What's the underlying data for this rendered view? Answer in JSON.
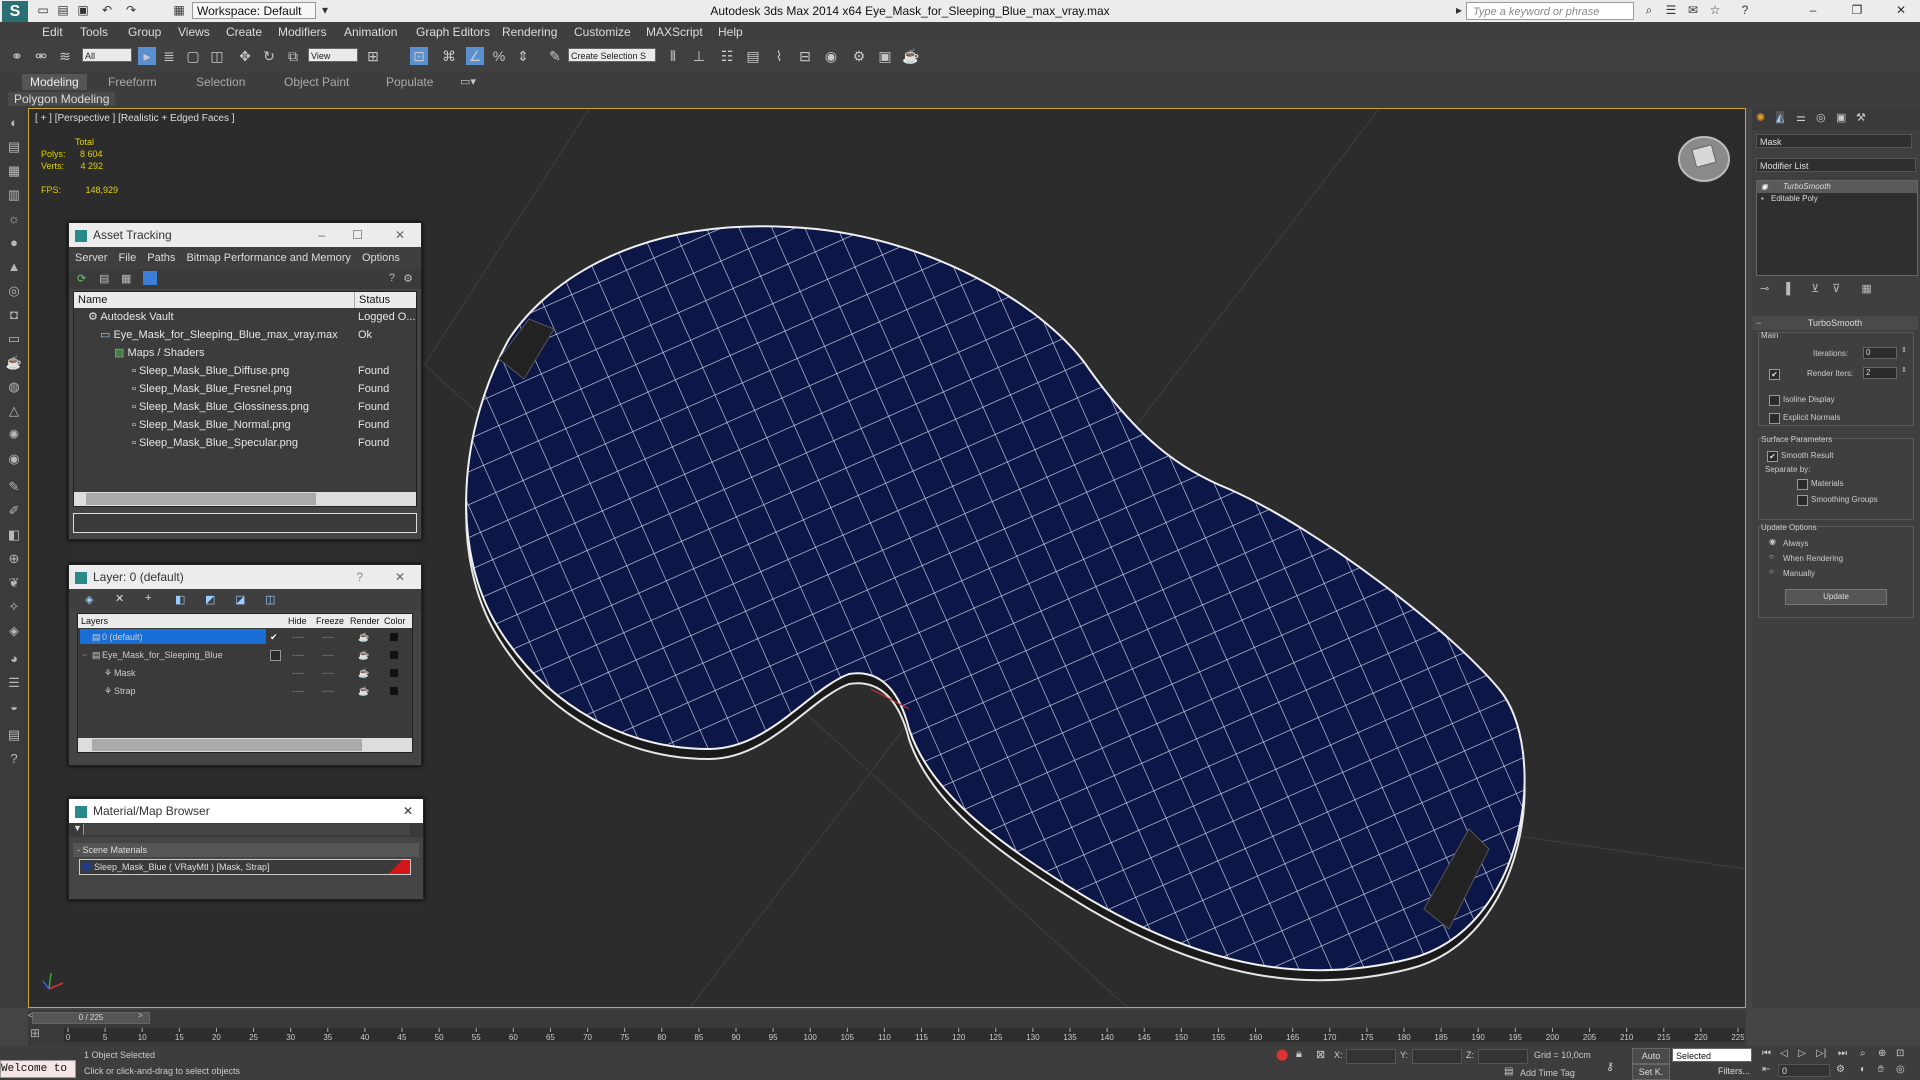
{
  "title_bar": {
    "app_icon": "3ds-max-logo-icon",
    "workspace": "Workspace: Default",
    "window_title": "Autodesk 3ds Max  2014 x64      Eye_Mask_for_Sleeping_Blue_max_vray.max",
    "search_placeholder": "Type a keyword or phrase"
  },
  "menu": [
    "Edit",
    "Tools",
    "Group",
    "Views",
    "Create",
    "Modifiers",
    "Animation",
    "Graph Editors",
    "Rendering",
    "Customize",
    "MAXScript",
    "Help"
  ],
  "toolbar": {
    "selection_filter": "All",
    "ref_coord": "View",
    "named_selection": "Create Selection S"
  },
  "ribbon": {
    "tabs": [
      "Modeling",
      "Freeform",
      "Selection",
      "Object Paint",
      "Populate"
    ],
    "active_tab": "Modeling",
    "subtab": "Polygon Modeling"
  },
  "viewport": {
    "label": "[ + ] [Perspective ] [Realistic + Edged Faces ]",
    "stats_total": "Total",
    "polys_label": "Polys:",
    "polys_value": "8 604",
    "verts_label": "Verts:",
    "verts_value": "4 292",
    "fps_label": "FPS:",
    "fps_value": "148,929"
  },
  "asset_tracking": {
    "title": "Asset Tracking",
    "menu": [
      "Server",
      "File",
      "Paths",
      "Bitmap Performance and Memory",
      "Options"
    ],
    "col_name": "Name",
    "col_status": "Status",
    "rows": [
      {
        "name": "Autodesk Vault",
        "status": "Logged O..."
      },
      {
        "name": "Eye_Mask_for_Sleeping_Blue_max_vray.max",
        "status": "Ok"
      },
      {
        "name": "Maps / Shaders",
        "status": ""
      },
      {
        "name": "Sleep_Mask_Blue_Diffuse.png",
        "status": "Found"
      },
      {
        "name": "Sleep_Mask_Blue_Fresnel.png",
        "status": "Found"
      },
      {
        "name": "Sleep_Mask_Blue_Glossiness.png",
        "status": "Found"
      },
      {
        "name": "Sleep_Mask_Blue_Normal.png",
        "status": "Found"
      },
      {
        "name": "Sleep_Mask_Blue_Specular.png",
        "status": "Found"
      }
    ]
  },
  "layer_panel": {
    "title": "Layer: 0 (default)",
    "help": "?",
    "col_layers": "Layers",
    "col_hide": "Hide",
    "col_freeze": "Freeze",
    "col_render": "Render",
    "col_color": "Color",
    "rows": [
      {
        "name": "0 (default)",
        "hide": "----",
        "freeze": "----"
      },
      {
        "name": "Eye_Mask_for_Sleeping_Blue",
        "hide": "----",
        "freeze": "----"
      },
      {
        "name": "Mask",
        "hide": "----",
        "freeze": "----"
      },
      {
        "name": "Strap",
        "hide": "----",
        "freeze": "----"
      }
    ]
  },
  "material_browser": {
    "title": "Material/Map Browser",
    "section": "- Scene Materials",
    "item": "Sleep_Mask_Blue  ( VRayMtl ) [Mask, Strap]"
  },
  "command_panel": {
    "object_name": "Mask",
    "modifier_list": "Modifier List",
    "stack": [
      "TurboSmooth",
      "Editable Poly"
    ],
    "rollout": "TurboSmooth",
    "main_label": "Main",
    "iterations_label": "Iterations:",
    "iterations_value": "0",
    "render_iters_label": "Render Iters:",
    "render_iters_value": "2",
    "isoline": "Isoline Display",
    "explicit_normals": "Explicit Normals",
    "surface_params": "Surface Parameters",
    "smooth_result": "Smooth Result",
    "separate_by": "Separate by:",
    "materials": "Materials",
    "smoothing_groups": "Smoothing Groups",
    "update_options": "Update Options",
    "always": "Always",
    "when_rendering": "When Rendering",
    "manually": "Manually",
    "update_button": "Update"
  },
  "timeline": {
    "frame_display": "0 / 225",
    "ticks": [
      "0",
      "5",
      "10",
      "15",
      "20",
      "25",
      "30",
      "35",
      "40",
      "45",
      "50",
      "55",
      "60",
      "65",
      "70",
      "75",
      "80",
      "85",
      "90",
      "95",
      "100",
      "105",
      "110",
      "115",
      "120",
      "125",
      "130",
      "135",
      "140",
      "145",
      "150",
      "155",
      "160",
      "165",
      "170",
      "175",
      "180",
      "185",
      "190",
      "195",
      "200",
      "205",
      "210",
      "215",
      "220",
      "225"
    ]
  },
  "status": {
    "script_listener": "Welcome to",
    "selected": "1 Object Selected",
    "prompt": "Click or click-and-drag to select objects",
    "x_label": "X:",
    "y_label": "Y:",
    "z_label": "Z:",
    "grid": "Grid = 10,0cm",
    "add_time_tag": "Add Time Tag",
    "auto": "Auto",
    "setk": "Set K.",
    "selected_mode": "Selected",
    "filters": "Filters...",
    "frame_value": "0"
  },
  "colors": {
    "mask_fill": "#0c1748",
    "viewport_bg": "#2c2c2c",
    "selection_blue": "#1a6fd6",
    "viewport_border": "#cfa53a",
    "stats_yellow": "#e0d000"
  }
}
